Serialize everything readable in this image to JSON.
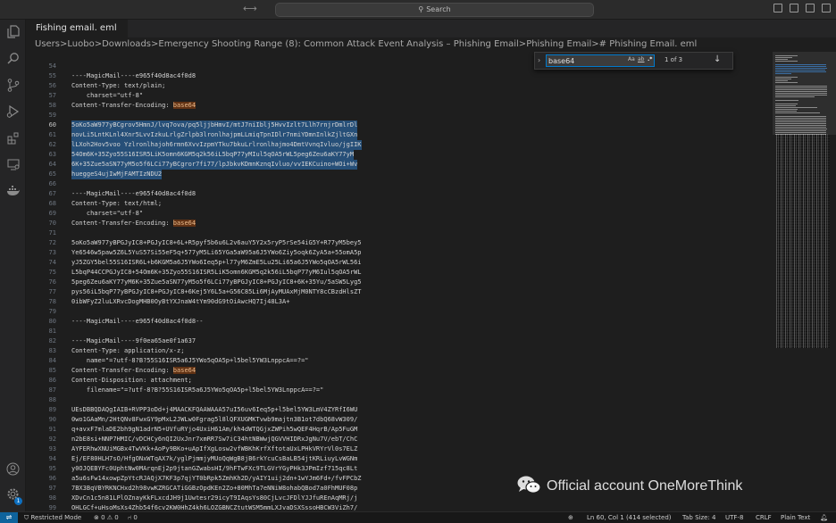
{
  "titlebar": {
    "nav_arrows": "⟷",
    "search_label": "Search"
  },
  "activity": {
    "explorer_icon": "files-icon",
    "search_icon": "search-icon",
    "scm_icon": "source-control-icon",
    "debug_icon": "run-debug-icon",
    "extensions_icon": "extensions-icon",
    "remote_icon": "remote-explorer-icon",
    "docker_icon": "docker-icon",
    "account_icon": "account-icon",
    "settings_icon": "gear-icon",
    "settings_badge": "1"
  },
  "tab": {
    "label": "Fishing email. eml"
  },
  "breadcrumb": "Users>Luobo>Downloads>Emergency Shooting Range (8): Common Attack Event Analysis – Phishing Email>Phishing Email># Phishing Email. eml",
  "find": {
    "value": "base64",
    "opt_case": "Aa",
    "opt_word": "ab",
    "opt_regex": ".*",
    "count": "1 of 3",
    "next_icon": "↓"
  },
  "editor": {
    "lines": [
      {
        "n": "54",
        "t": ""
      },
      {
        "n": "55",
        "t": "----MagicMail----e965f40d8ac4f0d8"
      },
      {
        "n": "56",
        "t": "Content-Type: text/plain;"
      },
      {
        "n": "57",
        "t": "    charset=\"utf-8\""
      },
      {
        "n": "58",
        "t": "Content-Transfer-Encoding: ",
        "h": "base64"
      },
      {
        "n": "59",
        "t": ""
      },
      {
        "n": "60",
        "t": "5oKo5aW977yBCgrov5HmnJ/lvq7ova/pq5ljjbHmvI/mtJ7niIblj5HvvIzlt7Llh7rnjrDmlrDl",
        "sel": true,
        "cur": true
      },
      {
        "n": "61",
        "t": "novLi5LntKLnl4Xnr5LvvIzkuLrlgZrlpb3lronlhajpmLLmiqTpnIDlr7nmiYDmnInlkZjltGXn",
        "sel": true
      },
      {
        "n": "62",
        "t": "lLXoh2Hov5voo Yzlronlhajoh6rmn6XvvIzpmYTku7bkuLrlronlhajmo4DmtVvnqIvluo/jgIIK",
        "sel": true
      },
      {
        "n": "63",
        "t": "54Om6K+35Zyo55S16ISR5LiK5omn6KGM5q2k56iL5bqP77yMIul5qOA5rWL5peg6Zeu6aKY77yM",
        "sel": true
      },
      {
        "n": "64",
        "t": "6K+35Zue5aSN77yM5o5f6LCi77yBCgror7fi77/lpJbkvKDmnKznqIvluo/vvIEKCuino+WOi+Wv",
        "sel": true
      },
      {
        "n": "65",
        "t": "hueggeS4ujIwMjFAMTIzNDU2",
        "sel": true
      },
      {
        "n": "66",
        "t": ""
      },
      {
        "n": "67",
        "t": "----MagicMail----e965f40d8ac4f0d8"
      },
      {
        "n": "68",
        "t": "Content-Type: text/html;"
      },
      {
        "n": "69",
        "t": "    charset=\"utf-8\""
      },
      {
        "n": "70",
        "t": "Content-Transfer-Encoding: ",
        "h": "base64"
      },
      {
        "n": "71",
        "t": ""
      },
      {
        "n": "72",
        "t": "5oKo5aW977yBPGJyIC8+PGJyIC8+6L+R5pyf5b6u6L2v6auY5Y2x5ryP5rSe54iG5Y+R77yM5bey5"
      },
      {
        "n": "73",
        "t": "Ye6546w5paw5Z6L5YuS57Si55eF5q+577yM5Li65YGa5aW95a6J5YWo6Ziy5oqk6ZyA5a+55omA5p"
      },
      {
        "n": "74",
        "t": "yJ5ZGY5bel55S16ISR6L+b6KGM5a6J5YWo6Ieq5p+l77yM6ZmE5Lu25Li65a6J5YWo5qOA5rWL56i"
      },
      {
        "n": "75",
        "t": "L5bqP44CCPGJyIC8+54Om6K+35Zyo55S16ISR5LiK5omn6KGM5q2k56iL5bqP77yM6Iul5qOA5rWL"
      },
      {
        "n": "76",
        "t": "5peg6Zeu6aKY77yM6K+35Zue5aSN77yM5o5f6LCi77yBPGJyIC8+PGJyIC8+6K+35Yu/5aSW5Lyg5"
      },
      {
        "n": "77",
        "t": "pys56iL5bqP77yBPGJyIC8+PGJyIC8+6Kej5Y6L5a+G56C85Li6MjAyMUAxMjM0NTY8cCBzdHlsZT"
      },
      {
        "n": "78",
        "t": "0ibWFyZ2luLXRvcDogMHB0OyBtYXJnaW4tYm90dG9tOiAwcHQ7Ij48L3A+"
      },
      {
        "n": "79",
        "t": ""
      },
      {
        "n": "80",
        "t": "----MagicMail----e965f40d8ac4f0d8--"
      },
      {
        "n": "81",
        "t": ""
      },
      {
        "n": "82",
        "t": "----MagicMail----9f0ea65ae0f1a637"
      },
      {
        "n": "83",
        "t": "Content-Type: application/x-z;"
      },
      {
        "n": "84",
        "t": "    name=\"=?utf-8?B?55S16ISR5a6J5YWo5qOA5p+l5bel5YW3LnppcA==?=\""
      },
      {
        "n": "85",
        "t": "Content-Transfer-Encoding: ",
        "h": "base64"
      },
      {
        "n": "86",
        "t": "Content-Disposition: attachment;"
      },
      {
        "n": "87",
        "t": "    filename=\"=?utf-8?B?55S16ISR5a6J5YWo5qOA5p+l5bel5YW3LnppcA==?=\""
      },
      {
        "n": "88",
        "t": ""
      },
      {
        "n": "89",
        "t": "UEsDBBQDAQgIAIB+RVPP3oDd+j4MAACKFQAAWAAA57uI56uv6Ieq5p+l5bel5YW3LmV4ZYRfI6WU"
      },
      {
        "n": "90",
        "t": "0wo1GAaMn/2HtQNv8FwxGY9pMxL2JWLw0Fgrag5l8lQFXUGMKTvwb9majtn3B1ot7dbQ68vW309/"
      },
      {
        "n": "91",
        "t": "q+avxF7mlaDE2bh9gN1adrN5+UVfuRYjo4UxiH61Am/kh4dWTQGjxZWPih5wQEF4HqrB/Ap5FuGM"
      },
      {
        "n": "92",
        "t": "n2bE8si+NNP7HMIC/vDCHCy6nQI2UxJnr7xmRR7Sw7iC34htNBWwjQGVVHIDRxJgNu7V/ebT/ChC"
      },
      {
        "n": "93",
        "t": "AYFERhwXNUiMGBx4TwVKk+AoPy9BKo+uApIfXgLosw2vfWBKhKrfXftotaUxLPHkVRYrVl0s7ELZ"
      },
      {
        "n": "94",
        "t": "Ej/EF80HLH7sO/HfgONxWTqAX7k/yglPjmmjyMUoQqWgB8jB6rkYcuCsBaLB54jtKRLiuyLvWGNm"
      },
      {
        "n": "95",
        "t": "y0OJQEBYFc0UphtNw0MArqnEj2p9jtanGZwabsHI/9hFTwFXc9TLGVrYGyPHk3JPmIzf715qc8Lt"
      },
      {
        "n": "96",
        "t": "a5u6sFw14xowpZpYtcRJAQjX7KF3p7qjYT0bRpk5ZmhKh2D/yAIY1uij2dn+1wYJm6Fd+/fvFPCbZ"
      },
      {
        "n": "97",
        "t": "7BX3BqVBYRKNCHxd2h98vwKZRGCATiGGBzOpdKEn2Zo+80MhTa7eNNiW8ohabQBod7a0FhMUF08p"
      },
      {
        "n": "98",
        "t": "XDvCn1c5n81LPlOZnayKkFLxcdJH9j1Uwtesr29icyT9IAqsYs80CjLvcJFDlYJJfuREnAqMRj/j"
      },
      {
        "n": "99",
        "t": "OHLGCf+uHsoMsXs4Zhb54f6cv2KW0HhZ4kh6LOZGBNCZtutWSM5mmLXJvaDSXSssoHBCW3ViZh7/"
      }
    ]
  },
  "watermark": {
    "text": "Official account OneMoreThink",
    "icon": "wechat-icon"
  },
  "status": {
    "remote_icon": "remote-icon",
    "restricted": "Restricted Mode",
    "problems": "⊗ 0 ⚠ 0",
    "ports": "⑁ 0",
    "zoom_icon": "zoom-icon",
    "position": "Ln 60, Col 1 (414 selected)",
    "tab_size": "Tab Size: 4",
    "encoding": "UTF-8",
    "eol": "CRLF",
    "language": "Plain Text",
    "bell_icon": "bell-icon"
  }
}
